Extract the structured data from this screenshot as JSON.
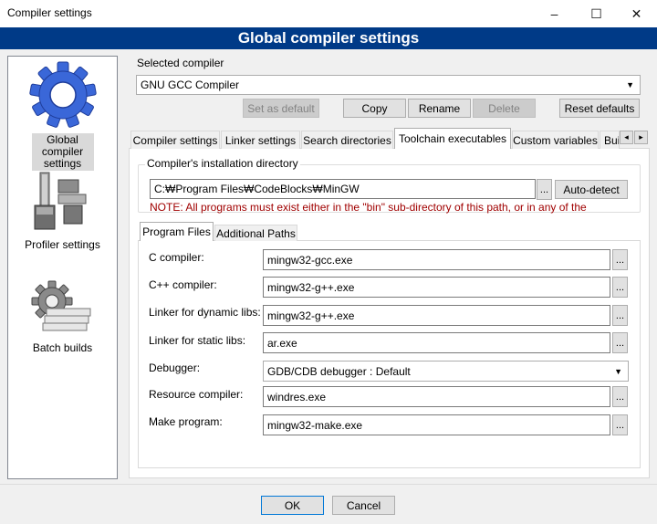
{
  "window": {
    "title": "Compiler settings",
    "minimize": "–",
    "maximize": "☐",
    "close": "✕"
  },
  "banner": "Global compiler settings",
  "sidebar": {
    "items": [
      {
        "label": "Global compiler settings",
        "icon": "gear-icon"
      },
      {
        "label": "Profiler settings",
        "icon": "profiler-icon"
      },
      {
        "label": "Batch builds",
        "icon": "batch-builds-icon"
      }
    ]
  },
  "selected_compiler": {
    "label": "Selected compiler",
    "value": "GNU GCC Compiler"
  },
  "compiler_buttons": {
    "set_default": "Set as default",
    "copy": "Copy",
    "rename": "Rename",
    "delete": "Delete",
    "reset": "Reset defaults"
  },
  "tabs": [
    "Compiler settings",
    "Linker settings",
    "Search directories",
    "Toolchain executables",
    "Custom variables",
    "Bui"
  ],
  "tab_scroll": {
    "left": "◂",
    "right": "▸"
  },
  "install_dir": {
    "label": "Compiler's installation directory",
    "value": "C:₩Program Files₩CodeBlocks₩MinGW",
    "browse": "...",
    "autodetect": "Auto-detect",
    "note": "NOTE: All programs must exist either in the \"bin\" sub-directory of this path, or in any of the"
  },
  "subtabs": [
    "Program Files",
    "Additional Paths"
  ],
  "programs": {
    "c_compiler": {
      "label": "C compiler:",
      "value": "mingw32-gcc.exe"
    },
    "cpp_compiler": {
      "label": "C++ compiler:",
      "value": "mingw32-g++.exe"
    },
    "linker_dynamic": {
      "label": "Linker for dynamic libs:",
      "value": "mingw32-g++.exe"
    },
    "linker_static": {
      "label": "Linker for static libs:",
      "value": "ar.exe"
    },
    "debugger": {
      "label": "Debugger:",
      "value": "GDB/CDB debugger : Default"
    },
    "resource_compiler": {
      "label": "Resource compiler:",
      "value": "windres.exe"
    },
    "make_program": {
      "label": "Make program:",
      "value": "mingw32-make.exe"
    },
    "browse": "..."
  },
  "footer": {
    "ok": "OK",
    "cancel": "Cancel"
  },
  "colors": {
    "banner": "#003a87",
    "note": "#a00000",
    "gear_blue": "#3a67d8"
  }
}
